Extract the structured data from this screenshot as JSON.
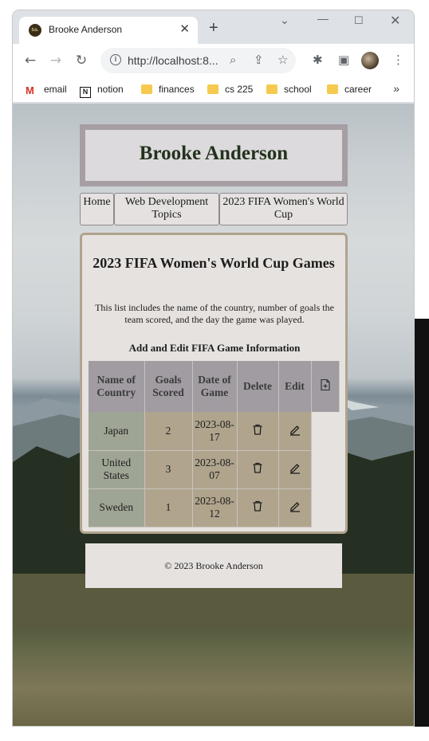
{
  "browser": {
    "tab_title": "Brooke Anderson",
    "favicon_text": "ba.",
    "url": "http://localhost:8...",
    "bookmarks": [
      {
        "label": "email",
        "icon": "gmail-icon"
      },
      {
        "label": "notion",
        "icon": "notion-icon"
      },
      {
        "label": "finances",
        "icon": "folder-icon"
      },
      {
        "label": "cs 225",
        "icon": "folder-icon"
      },
      {
        "label": "school",
        "icon": "folder-icon"
      },
      {
        "label": "career",
        "icon": "folder-icon"
      }
    ],
    "more_bookmarks": "»"
  },
  "site": {
    "title": "Brooke Anderson",
    "nav": [
      {
        "label": "Home"
      },
      {
        "label": "Web Development Topics"
      },
      {
        "label": "2023 FIFA Women's World Cup"
      }
    ]
  },
  "main": {
    "heading": "2023 FIFA Women's World Cup Games",
    "description": "This list includes the name of the country, number of goals the team scored, and the day the game was played.",
    "subheading": "Add and Edit FIFA Game Information",
    "table": {
      "headers": {
        "country": "Name of Country",
        "goals": "Goals Scored",
        "date": "Date of Game",
        "delete": "Delete",
        "edit": "Edit",
        "add_icon": "file-add-icon"
      },
      "rows": [
        {
          "country": "Japan",
          "goals": "2",
          "date": "2023-08-17"
        },
        {
          "country": "United States",
          "goals": "3",
          "date": "2023-08-07"
        },
        {
          "country": "Sweden",
          "goals": "1",
          "date": "2023-08-12"
        }
      ]
    }
  },
  "footer": {
    "text": "© 2023 Brooke Anderson"
  }
}
